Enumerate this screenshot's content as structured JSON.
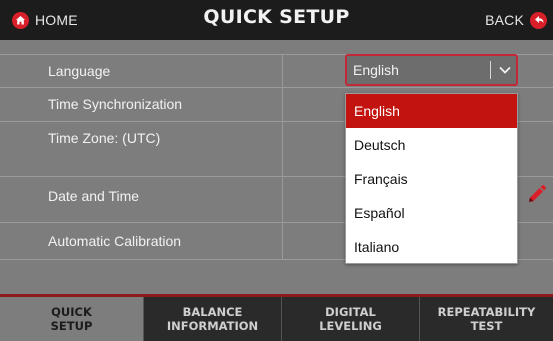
{
  "header": {
    "home_label": "HOME",
    "title": "QUICK SETUP",
    "back_label": "BACK"
  },
  "rows": [
    {
      "label": "Language"
    },
    {
      "label": "Time Synchronization"
    },
    {
      "label": "Time Zone: (UTC)"
    },
    {
      "label": "Date and Time"
    },
    {
      "label": "Automatic Calibration"
    }
  ],
  "language_select": {
    "value": "English",
    "options": [
      "English",
      "Deutsch",
      "Français",
      "Español",
      "Italiano"
    ],
    "selected_index": 0
  },
  "tabs": [
    {
      "line1": "QUICK",
      "line2": "SETUP",
      "active": true
    },
    {
      "line1": "BALANCE",
      "line2": "INFORMATION",
      "active": false
    },
    {
      "line1": "DIGITAL",
      "line2": "LEVELING",
      "active": false
    },
    {
      "line1": "REPEATABILITY",
      "line2": "TEST",
      "active": false
    }
  ],
  "colors": {
    "accent": "#d91f2a",
    "header_bg": "#1c1c1c",
    "panel_bg": "#7d7d7d",
    "selected_option_bg": "#c2130f"
  },
  "icons": {
    "home": "home-icon",
    "back": "back-arrow-icon",
    "dropdown": "chevron-down-icon",
    "edit": "pencil-icon"
  }
}
